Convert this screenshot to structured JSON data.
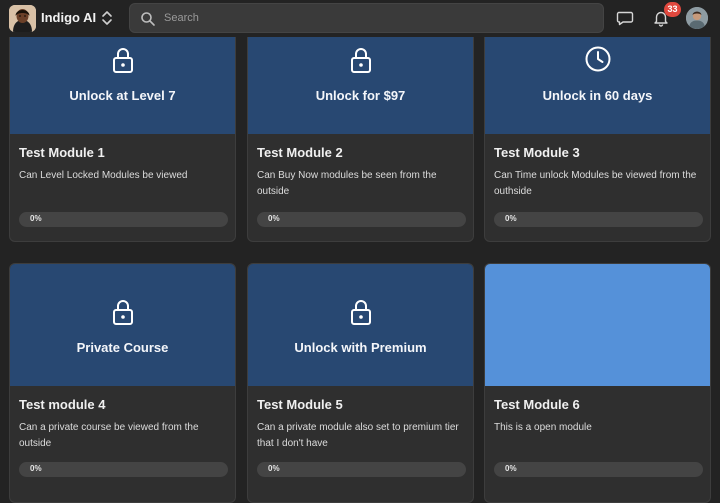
{
  "header": {
    "brand_name": "Indigo AI",
    "search_placeholder": "Search",
    "notification_count": "33"
  },
  "colors": {
    "locked_thumb": "#284872",
    "open_thumb": "#5591d9",
    "badge": "#e0483e"
  },
  "modules": [
    {
      "thumb_label": "Unlock at Level 7",
      "icon": "lock-icon",
      "title": "Test Module 1",
      "description": "Can Level Locked Modules be viewed",
      "progress_label": "0%",
      "progress": 0
    },
    {
      "thumb_label": "Unlock for $97",
      "icon": "lock-icon",
      "title": "Test Module 2",
      "description": "Can Buy Now modules be seen from the outside",
      "progress_label": "0%",
      "progress": 0
    },
    {
      "thumb_label": "Unlock in 60 days",
      "icon": "clock-icon",
      "title": "Test Module 3",
      "description": "Can Time unlock Modules be viewed from the outhside",
      "progress_label": "0%",
      "progress": 0
    },
    {
      "thumb_label": "Private Course",
      "icon": "lock-icon",
      "title": "Test module 4",
      "description": "Can a private course be viewed from the outside",
      "progress_label": "0%",
      "progress": 0
    },
    {
      "thumb_label": "Unlock with Premium",
      "icon": "lock-icon",
      "title": "Test Module 5",
      "description": "Can a private module also set to premium tier that I don't have",
      "progress_label": "0%",
      "progress": 0
    },
    {
      "thumb_label": "",
      "icon": "",
      "title": "Test Module 6",
      "description": "This is a open module",
      "progress_label": "0%",
      "progress": 0
    }
  ]
}
